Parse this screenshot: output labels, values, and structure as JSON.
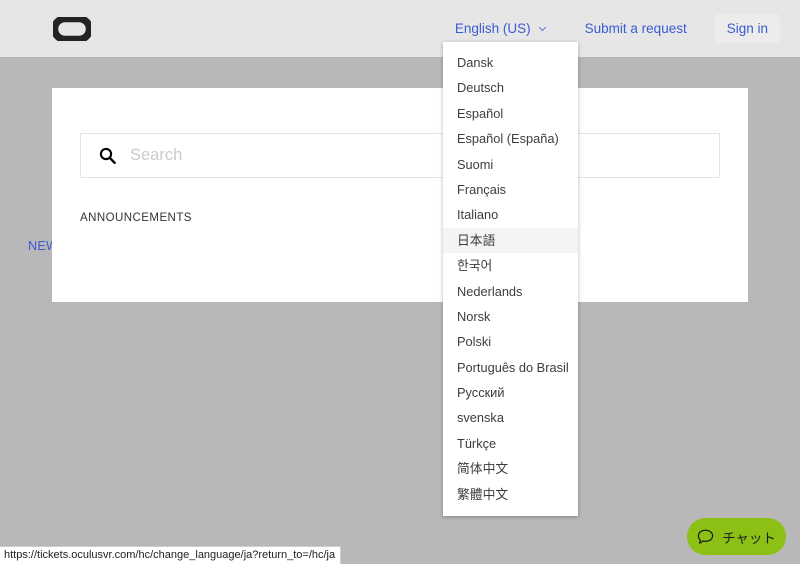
{
  "header": {
    "logo_icon": "oculus-logo-icon",
    "language_selector": {
      "label": "English (US)",
      "chevron_icon": "chevron-down-icon"
    },
    "submit_request_label": "Submit a request",
    "sign_in_label": "Sign in",
    "link_color": "#3b5cd4",
    "background_color": "#e6e6e6"
  },
  "language_dropdown": {
    "items": [
      {
        "label": "Dansk",
        "highlighted": false
      },
      {
        "label": "Deutsch",
        "highlighted": false
      },
      {
        "label": "Español",
        "highlighted": false
      },
      {
        "label": "Español (España)",
        "highlighted": false
      },
      {
        "label": "Suomi",
        "highlighted": false
      },
      {
        "label": "Français",
        "highlighted": false
      },
      {
        "label": "Italiano",
        "highlighted": false
      },
      {
        "label": "日本語",
        "highlighted": true
      },
      {
        "label": "한국어",
        "highlighted": false
      },
      {
        "label": "Nederlands",
        "highlighted": false
      },
      {
        "label": "Norsk",
        "highlighted": false
      },
      {
        "label": "Polski",
        "highlighted": false
      },
      {
        "label": "Português do Brasil",
        "highlighted": false
      },
      {
        "label": "Русский",
        "highlighted": false
      },
      {
        "label": "svenska",
        "highlighted": false
      },
      {
        "label": "Türkçe",
        "highlighted": false
      },
      {
        "label": "简体中文",
        "highlighted": false
      },
      {
        "label": "繁體中文",
        "highlighted": false
      }
    ],
    "highlight_color": "#f4f4f4"
  },
  "main": {
    "search": {
      "placeholder": "Search",
      "value": "",
      "icon": "search-icon"
    },
    "announcements_heading": "ANNOUNCEMENTS",
    "announcement_link": "NEW OCULUS SUPPORT CENTER LOCATION",
    "link_color": "#3b5cd4"
  },
  "chat_widget": {
    "label": "チャット",
    "icon": "chat-bubble-icon",
    "background_color": "#8cc014"
  },
  "status_bar": {
    "url": "https://tickets.oculusvr.com/hc/change_language/ja?return_to=/hc/ja"
  },
  "page": {
    "background_color": "#b8b8b8",
    "card_background": "#ffffff"
  }
}
